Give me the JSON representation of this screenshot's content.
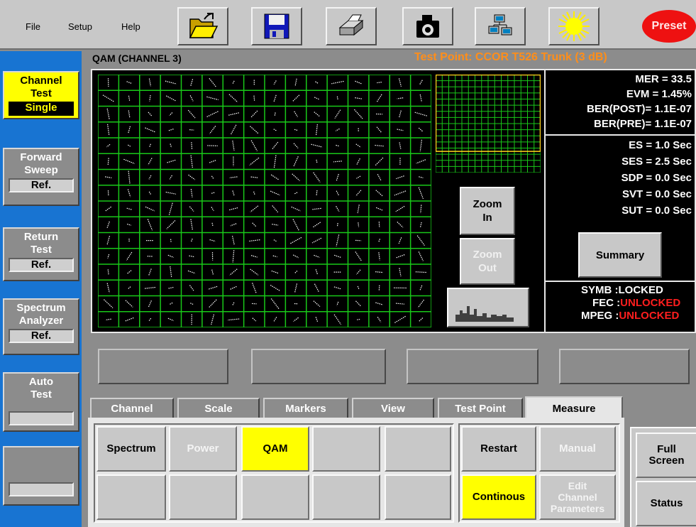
{
  "menu": {
    "file": "File",
    "setup": "Setup",
    "help": "Help"
  },
  "toolbar": {
    "icons": [
      "open-folder-icon",
      "save-disk-icon",
      "printer-icon",
      "camera-icon",
      "network-computers-icon",
      "sun-brightness-icon"
    ],
    "preset_label": "Preset"
  },
  "sidebar": {
    "channel_test": {
      "label_1": "Channel",
      "label_2": "Test",
      "sub": "Single"
    },
    "forward_sweep": {
      "label_1": "Forward",
      "label_2": "Sweep",
      "sub": "Ref."
    },
    "return_test": {
      "label_1": "Return",
      "label_2": "Test",
      "sub": "Ref."
    },
    "spectrum_analyzer": {
      "label_1": "Spectrum",
      "label_2": "Analyzer",
      "sub": "Ref."
    },
    "auto_test": {
      "label_1": "Auto",
      "label_2": "Test",
      "sub": ""
    },
    "blank": {
      "sub": ""
    }
  },
  "header": {
    "title": "QAM (CHANNEL 3)",
    "test_point": "Test Point: CCOR T526 Trunk (3  dB)"
  },
  "display": {
    "zoom_in_1": "Zoom",
    "zoom_in_2": "In",
    "zoom_out_1": "Zoom",
    "zoom_out_2": "Out",
    "summary_label": "Summary"
  },
  "stats": {
    "mer": "MER = 33.5",
    "evm": "EVM = 1.45%",
    "ber_post": "BER(POST)= 1.1E-07",
    "ber_pre": "BER(PRE)= 1.1E-07",
    "es": "ES = 1.0 Sec",
    "ses": "SES = 2.5 Sec",
    "sdp": "SDP = 0.0 Sec",
    "svt": "SVT = 0.0 Sec",
    "sut": "SUT = 0.0 Sec"
  },
  "lock_status": {
    "symb_label": "SYMB :",
    "symb_value": "LOCKED",
    "fec_label": "FEC :",
    "fec_value": "UNLOCKED",
    "mpeg_label": "MPEG :",
    "mpeg_value": "UNLOCKED"
  },
  "colors": {
    "grid": "#19c819",
    "lock_red": "#ff1e1e",
    "test_point": "#ff8e1a",
    "accent_yellow": "#ffff00",
    "left_blue": "#1874d2"
  },
  "tabs": [
    "Channel",
    "Scale",
    "Markers",
    "View",
    "Test Point",
    "Measure"
  ],
  "measure": {
    "spectrum": "Spectrum",
    "power": "Power",
    "qam": "QAM",
    "restart": "Restart",
    "manual": "Manual",
    "continous": "Continous",
    "edit_1": "Edit",
    "edit_2": "Channel",
    "edit_3": "Parameters"
  },
  "right": {
    "full_1": "Full",
    "full_2": "Screen",
    "status": "Status"
  }
}
